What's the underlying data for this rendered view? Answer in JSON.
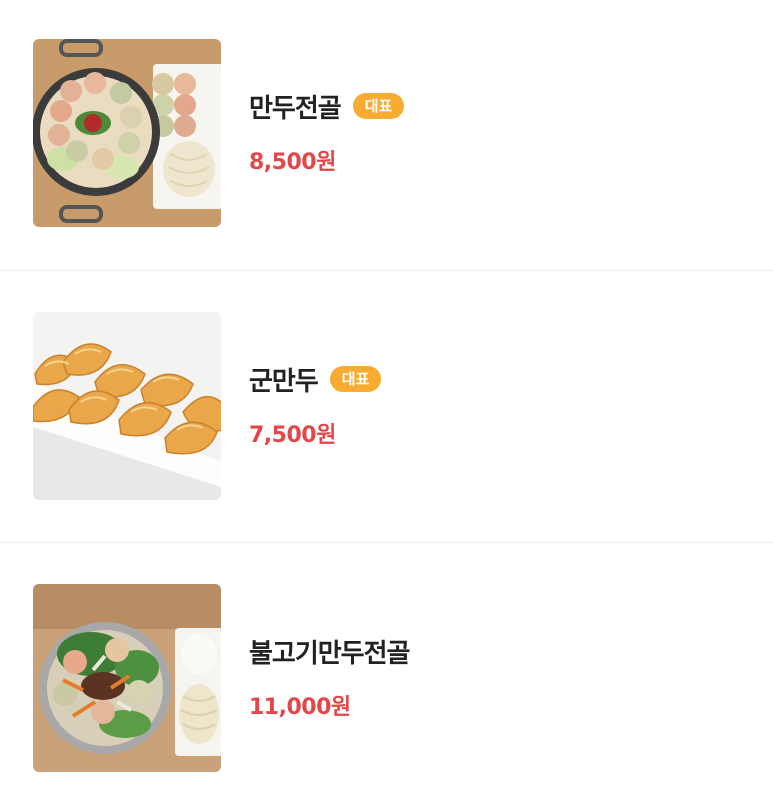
{
  "menu": {
    "items": [
      {
        "name": "만두전골",
        "badge": "대표",
        "price": "8,500원",
        "image_icon": "dumpling-hotpot-image"
      },
      {
        "name": "군만두",
        "badge": "대표",
        "price": "7,500원",
        "image_icon": "fried-dumplings-image"
      },
      {
        "name": "불고기만두전골",
        "badge": "",
        "price": "11,000원",
        "image_icon": "bulgogi-dumpling-hotpot-image"
      }
    ]
  },
  "colors": {
    "badge": "#f7ab31",
    "price": "#e2474a",
    "name": "#222222",
    "divider": "#ececec"
  }
}
